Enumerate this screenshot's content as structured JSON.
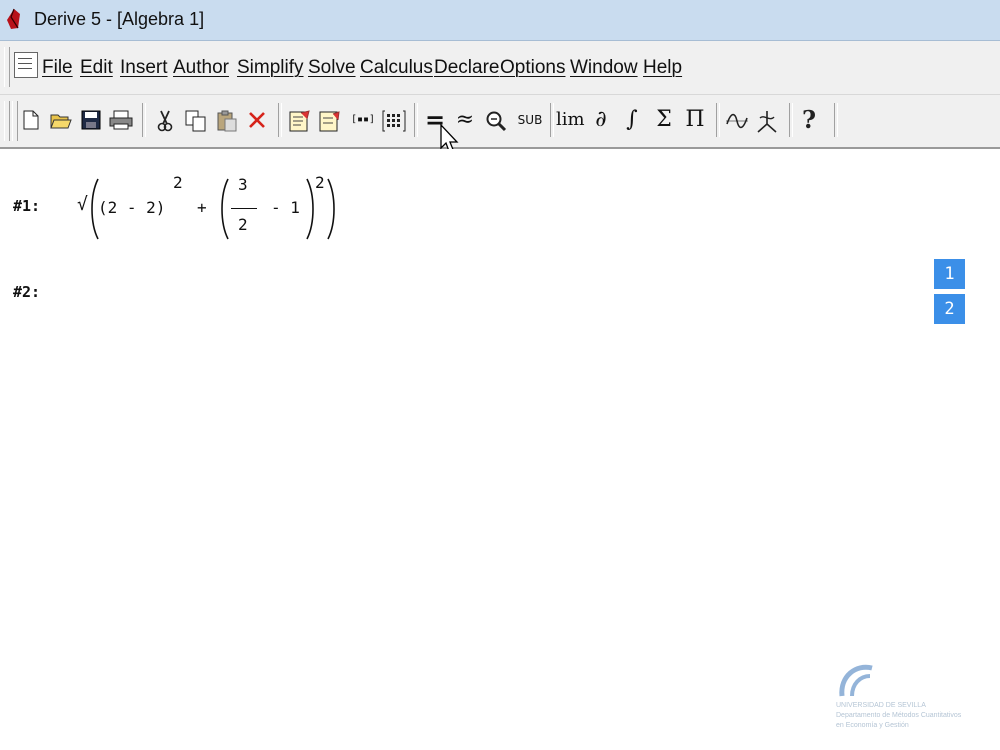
{
  "window": {
    "title": "Derive 5 - [Algebra 1]"
  },
  "menu": [
    "File",
    "Edit",
    "Insert",
    "Author",
    "Simplify",
    "Solve",
    "Calculus",
    "Declare",
    "Options",
    "Window",
    "Help"
  ],
  "toolbar": {
    "lim": "lim",
    "partial": "∂",
    "integral": "∫",
    "sum": "Σ",
    "product": "Π",
    "equals": "=",
    "approx": "≈",
    "sub": "SUB",
    "vector": "[▪▪]",
    "help": "?"
  },
  "expressions": [
    {
      "label": "#1:",
      "sqrt": "√",
      "term1": "(2 - 2)",
      "exp1": "2",
      "plus": "+",
      "numerator": "3",
      "denominator": "2",
      "minus_one": "- 1",
      "exp2": "2"
    },
    {
      "label": "#2:"
    }
  ],
  "side_panel": [
    "1",
    "2"
  ],
  "watermark": {
    "line1": "UNIVERSIDAD DE SEVILLA",
    "line2": "Departamento de Métodos Cuantitativos",
    "line3": "en Economía y Gestión"
  },
  "colors": {
    "accent": "#3b8fe8",
    "titlebar": "#c9dcef"
  }
}
